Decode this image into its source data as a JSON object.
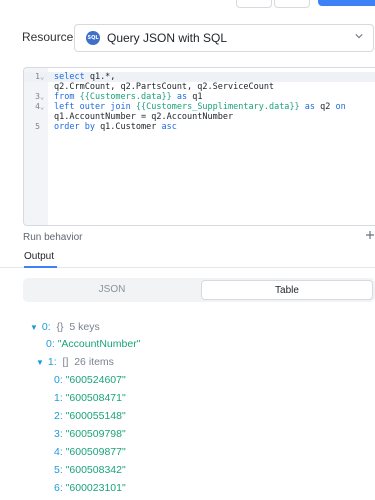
{
  "resource": {
    "label": "Resource",
    "badge": "SQL",
    "value": "Query JSON with SQL"
  },
  "editor": {
    "lines": [
      {
        "num": "1",
        "fold": "⌄",
        "parts": [
          [
            "kw",
            "select "
          ],
          [
            "pl",
            "q1.*,"
          ]
        ]
      },
      {
        "num": "",
        "fold": "",
        "parts": [
          [
            "pl",
            "q2.CrmCount, q2.PartsCount, q2.ServiceCount"
          ]
        ]
      },
      {
        "num": "3",
        "fold": "⌄",
        "parts": [
          [
            "kw",
            "from "
          ],
          [
            "br",
            "{{"
          ],
          [
            "tp",
            "Customers.data"
          ],
          [
            "br",
            "}}"
          ],
          [
            "kw",
            " as "
          ],
          [
            "pl",
            "q1"
          ]
        ]
      },
      {
        "num": "4",
        "fold": "⌄",
        "parts": [
          [
            "kw",
            "left outer join "
          ],
          [
            "br",
            "{{"
          ],
          [
            "tp",
            "Customers_Supplimentary.data"
          ],
          [
            "br",
            "}}"
          ],
          [
            "kw",
            " as "
          ],
          [
            "pl",
            "q2 "
          ],
          [
            "kw",
            "on"
          ]
        ]
      },
      {
        "num": "",
        "fold": "",
        "parts": [
          [
            "pl",
            "q1.AccountNumber = q2.AccountNumber"
          ]
        ]
      },
      {
        "num": "5",
        "fold": "",
        "parts": [
          [
            "kw",
            "order by "
          ],
          [
            "pl",
            "q1.Customer "
          ],
          [
            "kw",
            "asc"
          ]
        ]
      }
    ]
  },
  "run_behavior": "Run behavior",
  "output": {
    "tab": "Output",
    "json_label": "JSON",
    "table_label": "Table"
  },
  "tree": {
    "root": {
      "key": "0:",
      "type": "{}",
      "count": "5 keys"
    },
    "field0": {
      "key": "0:",
      "value": "\"AccountNumber\""
    },
    "field1": {
      "key": "1:",
      "type": "[]",
      "count": "26 items"
    },
    "items": [
      {
        "key": "0:",
        "value": "\"600524607\""
      },
      {
        "key": "1:",
        "value": "\"600508471\""
      },
      {
        "key": "2:",
        "value": "\"600055148\""
      },
      {
        "key": "3:",
        "value": "\"600509798\""
      },
      {
        "key": "4:",
        "value": "\"600509877\""
      },
      {
        "key": "5:",
        "value": "\"600508342\""
      },
      {
        "key": "6:",
        "value": "\"600023101\""
      }
    ]
  }
}
